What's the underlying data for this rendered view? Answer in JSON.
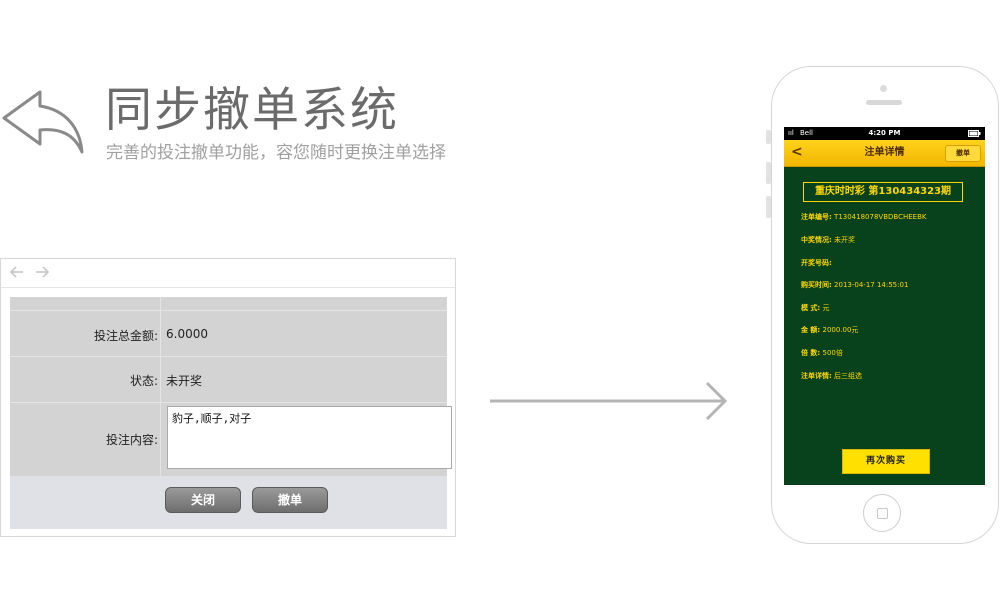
{
  "header": {
    "title": "同步撤单系统",
    "subtitle": "完善的投注撤单功能，容您随时更换注单选择"
  },
  "browser": {
    "form": {
      "rows": [
        {
          "label": "投注总金额:",
          "value": "6.0000"
        },
        {
          "label": "状态:",
          "value": "未开奖"
        },
        {
          "label": "投注内容:",
          "value": "豹子,顺子,对子"
        }
      ],
      "buttons": {
        "close": "关闭",
        "cancel": "撤单"
      }
    }
  },
  "phone": {
    "status_bar": {
      "carrier": "Bell",
      "time": "4:20 PM"
    },
    "nav": {
      "back": "<",
      "title": "注单详情",
      "cancel": "撤单"
    },
    "lottery_title": "重庆时时彩   第130434323期",
    "details": [
      {
        "key": "注单编号:",
        "value": "T130418078VBDBCHEEBK"
      },
      {
        "key": "中奖情况:",
        "value": "未开奖"
      },
      {
        "key": "开奖号码:",
        "value": ""
      },
      {
        "key": "购买时间:",
        "value": "2013-04-17    14:55:01"
      },
      {
        "key": "模    式:",
        "value": "元"
      },
      {
        "key": "金    额:",
        "value": "2000.00元"
      },
      {
        "key": "倍    数:",
        "value": "500倍"
      },
      {
        "key": "注单详情:",
        "value": "后三组选"
      }
    ],
    "buy_again": "再次购买"
  },
  "colors": {
    "phone_screen_bg": "#07421c",
    "accent_yellow": "#ffd800",
    "title_gray": "#6b6b6b"
  },
  "icons": [
    "back-arrow-icon",
    "browser-back-icon",
    "browser-forward-icon",
    "right-arrow-icon",
    "signal-icon",
    "battery-icon",
    "home-button-icon"
  ]
}
